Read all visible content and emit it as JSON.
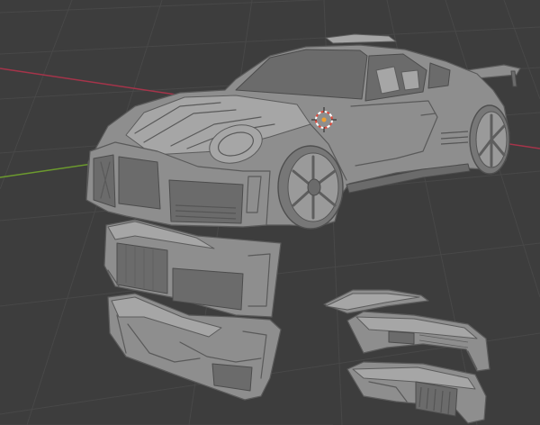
{
  "scene": {
    "background_color": "#3d3d3d",
    "grid_color": "#484848",
    "x_axis_color": "#a5344a",
    "y_axis_color": "#6c9a2e",
    "cursor_colors": [
      "#e14a3b",
      "#ffffff"
    ],
    "model_color": "#8e8e8e",
    "objects": [
      "car-body",
      "front-bumper",
      "bumper-variant-a",
      "bumper-variant-b",
      "rear-wing-piece",
      "rear-bumper-piece-a",
      "rear-bumper-piece-b"
    ]
  }
}
